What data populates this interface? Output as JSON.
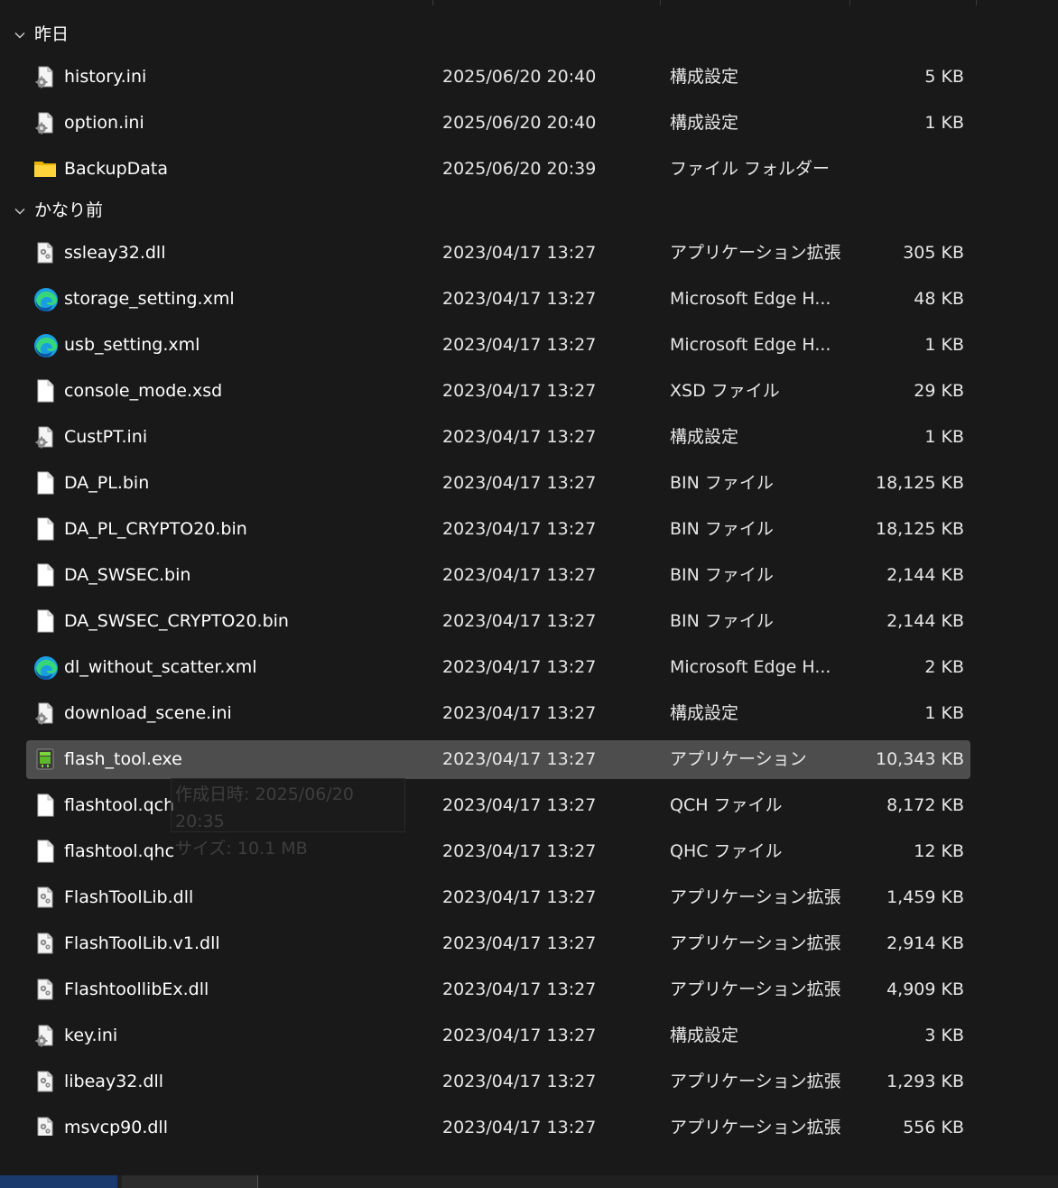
{
  "groups": [
    {
      "label": "昨日",
      "files": [
        {
          "name": "history.ini",
          "date": "2025/06/20 20:40",
          "type": "構成設定",
          "size": "5 KB",
          "icon": "settings-file-icon"
        },
        {
          "name": "option.ini",
          "date": "2025/06/20 20:40",
          "type": "構成設定",
          "size": "1 KB",
          "icon": "settings-file-icon"
        },
        {
          "name": "BackupData",
          "date": "2025/06/20 20:39",
          "type": "ファイル フォルダー",
          "size": "",
          "icon": "folder-icon"
        }
      ]
    },
    {
      "label": "かなり前",
      "files": [
        {
          "name": "ssleay32.dll",
          "date": "2023/04/17 13:27",
          "type": "アプリケーション拡張",
          "size": "305 KB",
          "icon": "dll-file-icon"
        },
        {
          "name": "storage_setting.xml",
          "date": "2023/04/17 13:27",
          "type": "Microsoft Edge H...",
          "size": "48 KB",
          "icon": "edge-icon"
        },
        {
          "name": "usb_setting.xml",
          "date": "2023/04/17 13:27",
          "type": "Microsoft Edge H...",
          "size": "1 KB",
          "icon": "edge-icon"
        },
        {
          "name": "console_mode.xsd",
          "date": "2023/04/17 13:27",
          "type": "XSD ファイル",
          "size": "29 KB",
          "icon": "blank-file-icon"
        },
        {
          "name": "CustPT.ini",
          "date": "2023/04/17 13:27",
          "type": "構成設定",
          "size": "1 KB",
          "icon": "settings-file-icon"
        },
        {
          "name": "DA_PL.bin",
          "date": "2023/04/17 13:27",
          "type": "BIN ファイル",
          "size": "18,125 KB",
          "icon": "blank-file-icon"
        },
        {
          "name": "DA_PL_CRYPTO20.bin",
          "date": "2023/04/17 13:27",
          "type": "BIN ファイル",
          "size": "18,125 KB",
          "icon": "blank-file-icon"
        },
        {
          "name": "DA_SWSEC.bin",
          "date": "2023/04/17 13:27",
          "type": "BIN ファイル",
          "size": "2,144 KB",
          "icon": "blank-file-icon"
        },
        {
          "name": "DA_SWSEC_CRYPTO20.bin",
          "date": "2023/04/17 13:27",
          "type": "BIN ファイル",
          "size": "2,144 KB",
          "icon": "blank-file-icon"
        },
        {
          "name": "dl_without_scatter.xml",
          "date": "2023/04/17 13:27",
          "type": "Microsoft Edge H...",
          "size": "2 KB",
          "icon": "edge-icon"
        },
        {
          "name": "download_scene.ini",
          "date": "2023/04/17 13:27",
          "type": "構成設定",
          "size": "1 KB",
          "icon": "settings-file-icon"
        },
        {
          "name": "flash_tool.exe",
          "date": "2023/04/17 13:27",
          "type": "アプリケーション",
          "size": "10,343 KB",
          "icon": "android-app-icon",
          "selected": true
        },
        {
          "name": "flashtool.qch",
          "date": "2023/04/17 13:27",
          "type": "QCH ファイル",
          "size": "8,172 KB",
          "icon": "blank-file-icon"
        },
        {
          "name": "flashtool.qhc",
          "date": "2023/04/17 13:27",
          "type": "QHC ファイル",
          "size": "12 KB",
          "icon": "blank-file-icon"
        },
        {
          "name": "FlashToolLib.dll",
          "date": "2023/04/17 13:27",
          "type": "アプリケーション拡張",
          "size": "1,459 KB",
          "icon": "dll-file-icon"
        },
        {
          "name": "FlashToolLib.v1.dll",
          "date": "2023/04/17 13:27",
          "type": "アプリケーション拡張",
          "size": "2,914 KB",
          "icon": "dll-file-icon"
        },
        {
          "name": "FlashtoollibEx.dll",
          "date": "2023/04/17 13:27",
          "type": "アプリケーション拡張",
          "size": "4,909 KB",
          "icon": "dll-file-icon"
        },
        {
          "name": "key.ini",
          "date": "2023/04/17 13:27",
          "type": "構成設定",
          "size": "3 KB",
          "icon": "settings-file-icon"
        },
        {
          "name": "libeay32.dll",
          "date": "2023/04/17 13:27",
          "type": "アプリケーション拡張",
          "size": "1,293 KB",
          "icon": "dll-file-icon"
        },
        {
          "name": "msvcp90.dll",
          "date": "2023/04/17 13:27",
          "type": "アプリケーション拡張",
          "size": "556 KB",
          "icon": "dll-file-icon"
        }
      ]
    }
  ],
  "tooltip": {
    "created": "作成日時: 2025/06/20 20:35",
    "size": "サイズ: 10.1 MB"
  }
}
